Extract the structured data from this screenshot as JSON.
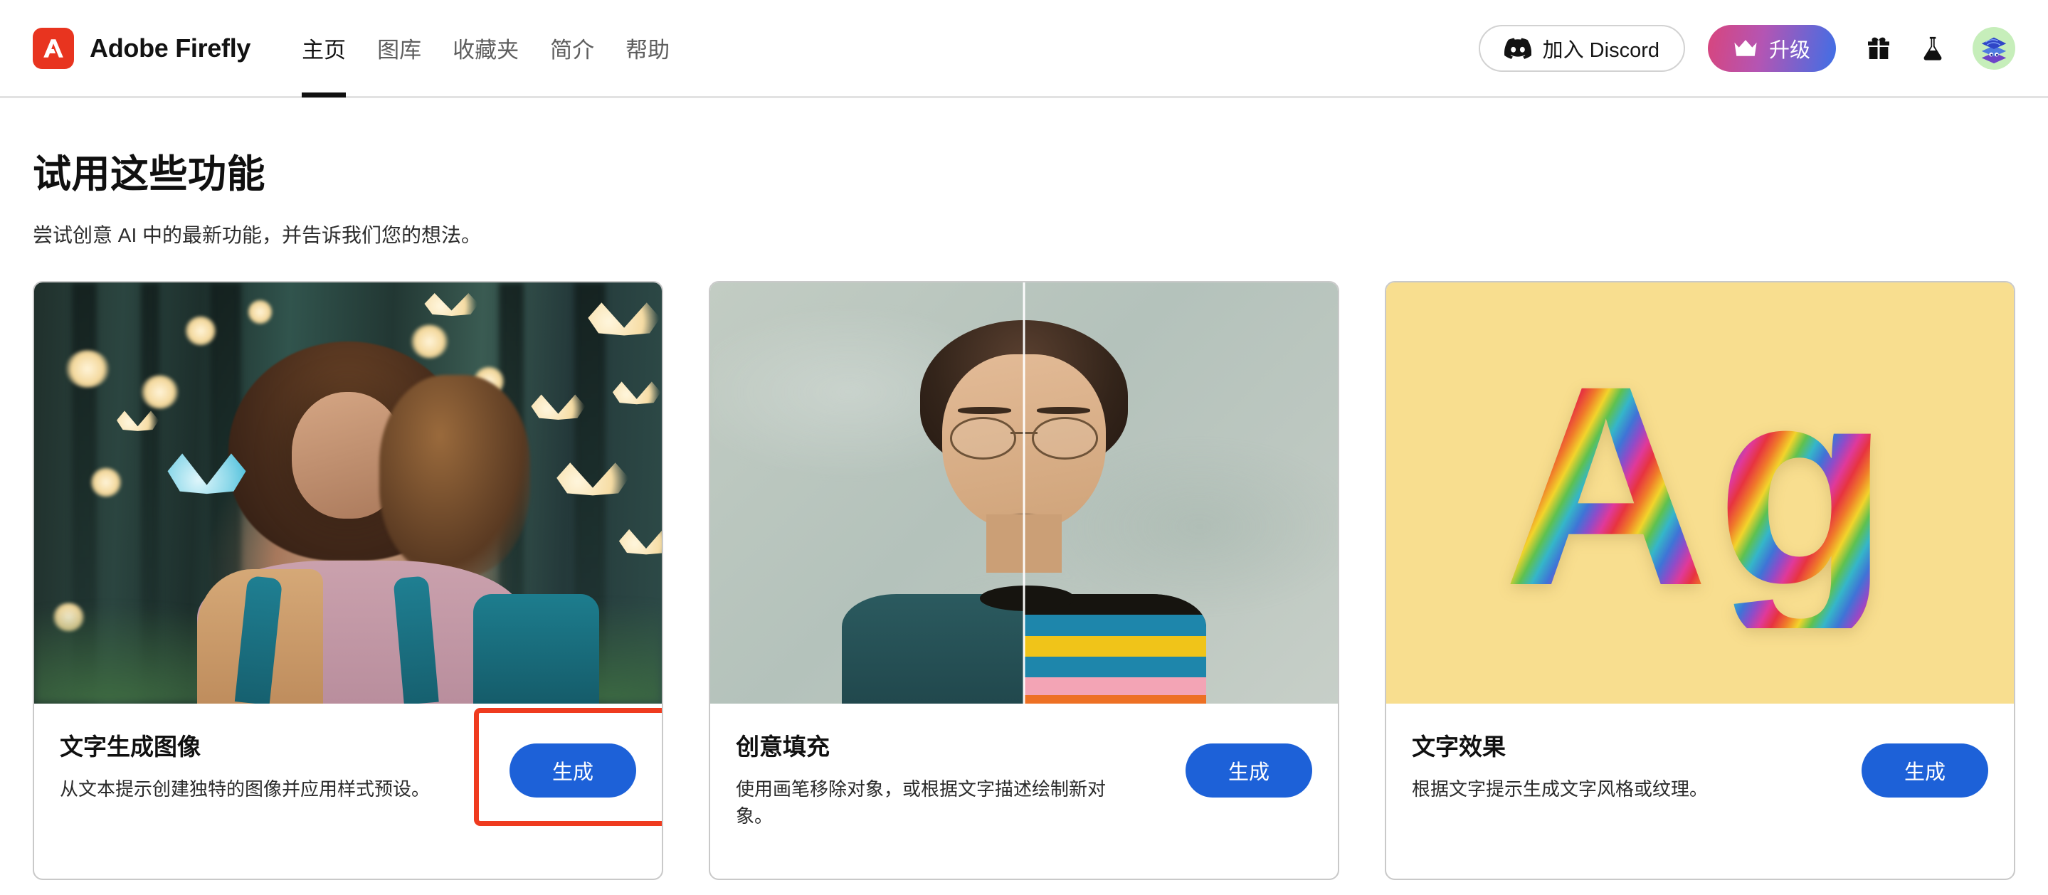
{
  "header": {
    "brand_name": "Adobe Firefly",
    "logo_icon": "adobe-a-icon",
    "nav": [
      {
        "label": "主页",
        "active": true
      },
      {
        "label": "图库",
        "active": false
      },
      {
        "label": "收藏夹",
        "active": false
      },
      {
        "label": "简介",
        "active": false
      },
      {
        "label": "帮助",
        "active": false
      }
    ],
    "discord_button": {
      "label": "加入 Discord",
      "icon": "discord-icon"
    },
    "upgrade_button": {
      "label": "升级",
      "icon": "crown-icon"
    },
    "gift_button": {
      "icon": "gift-icon"
    },
    "lab_button": {
      "icon": "flask-icon"
    },
    "avatar": {
      "icon": "user-avatar-icon"
    }
  },
  "main": {
    "title": "试用这些功能",
    "subtitle": "尝试创意 AI 中的最新功能，并告诉我们您的想法。",
    "cards": [
      {
        "title": "文字生成图像",
        "description": "从文本提示创建独特的图像并应用样式预设。",
        "button_label": "生成",
        "highlighted": true,
        "media": "girl-in-glowing-forest-image"
      },
      {
        "title": "创意填充",
        "description": "使用画笔移除对象，或根据文字描述绘制新对象。",
        "button_label": "生成",
        "highlighted": false,
        "media": "split-portrait-image"
      },
      {
        "title": "文字效果",
        "description": "根据文字提示生成文字风格或纹理。",
        "button_label": "生成",
        "highlighted": false,
        "media": "furry-rainbow-letters-image",
        "media_glyphs": "Ag"
      }
    ]
  },
  "colors": {
    "adobe_red": "#e8341f",
    "primary_blue": "#1d61d8",
    "highlight_red": "#ef3b1f",
    "upgrade_gradient_start": "#d8457d",
    "upgrade_gradient_end": "#3e6fe6",
    "card_border": "#c9c9c9",
    "text_effect_background": "#f8de8f"
  }
}
